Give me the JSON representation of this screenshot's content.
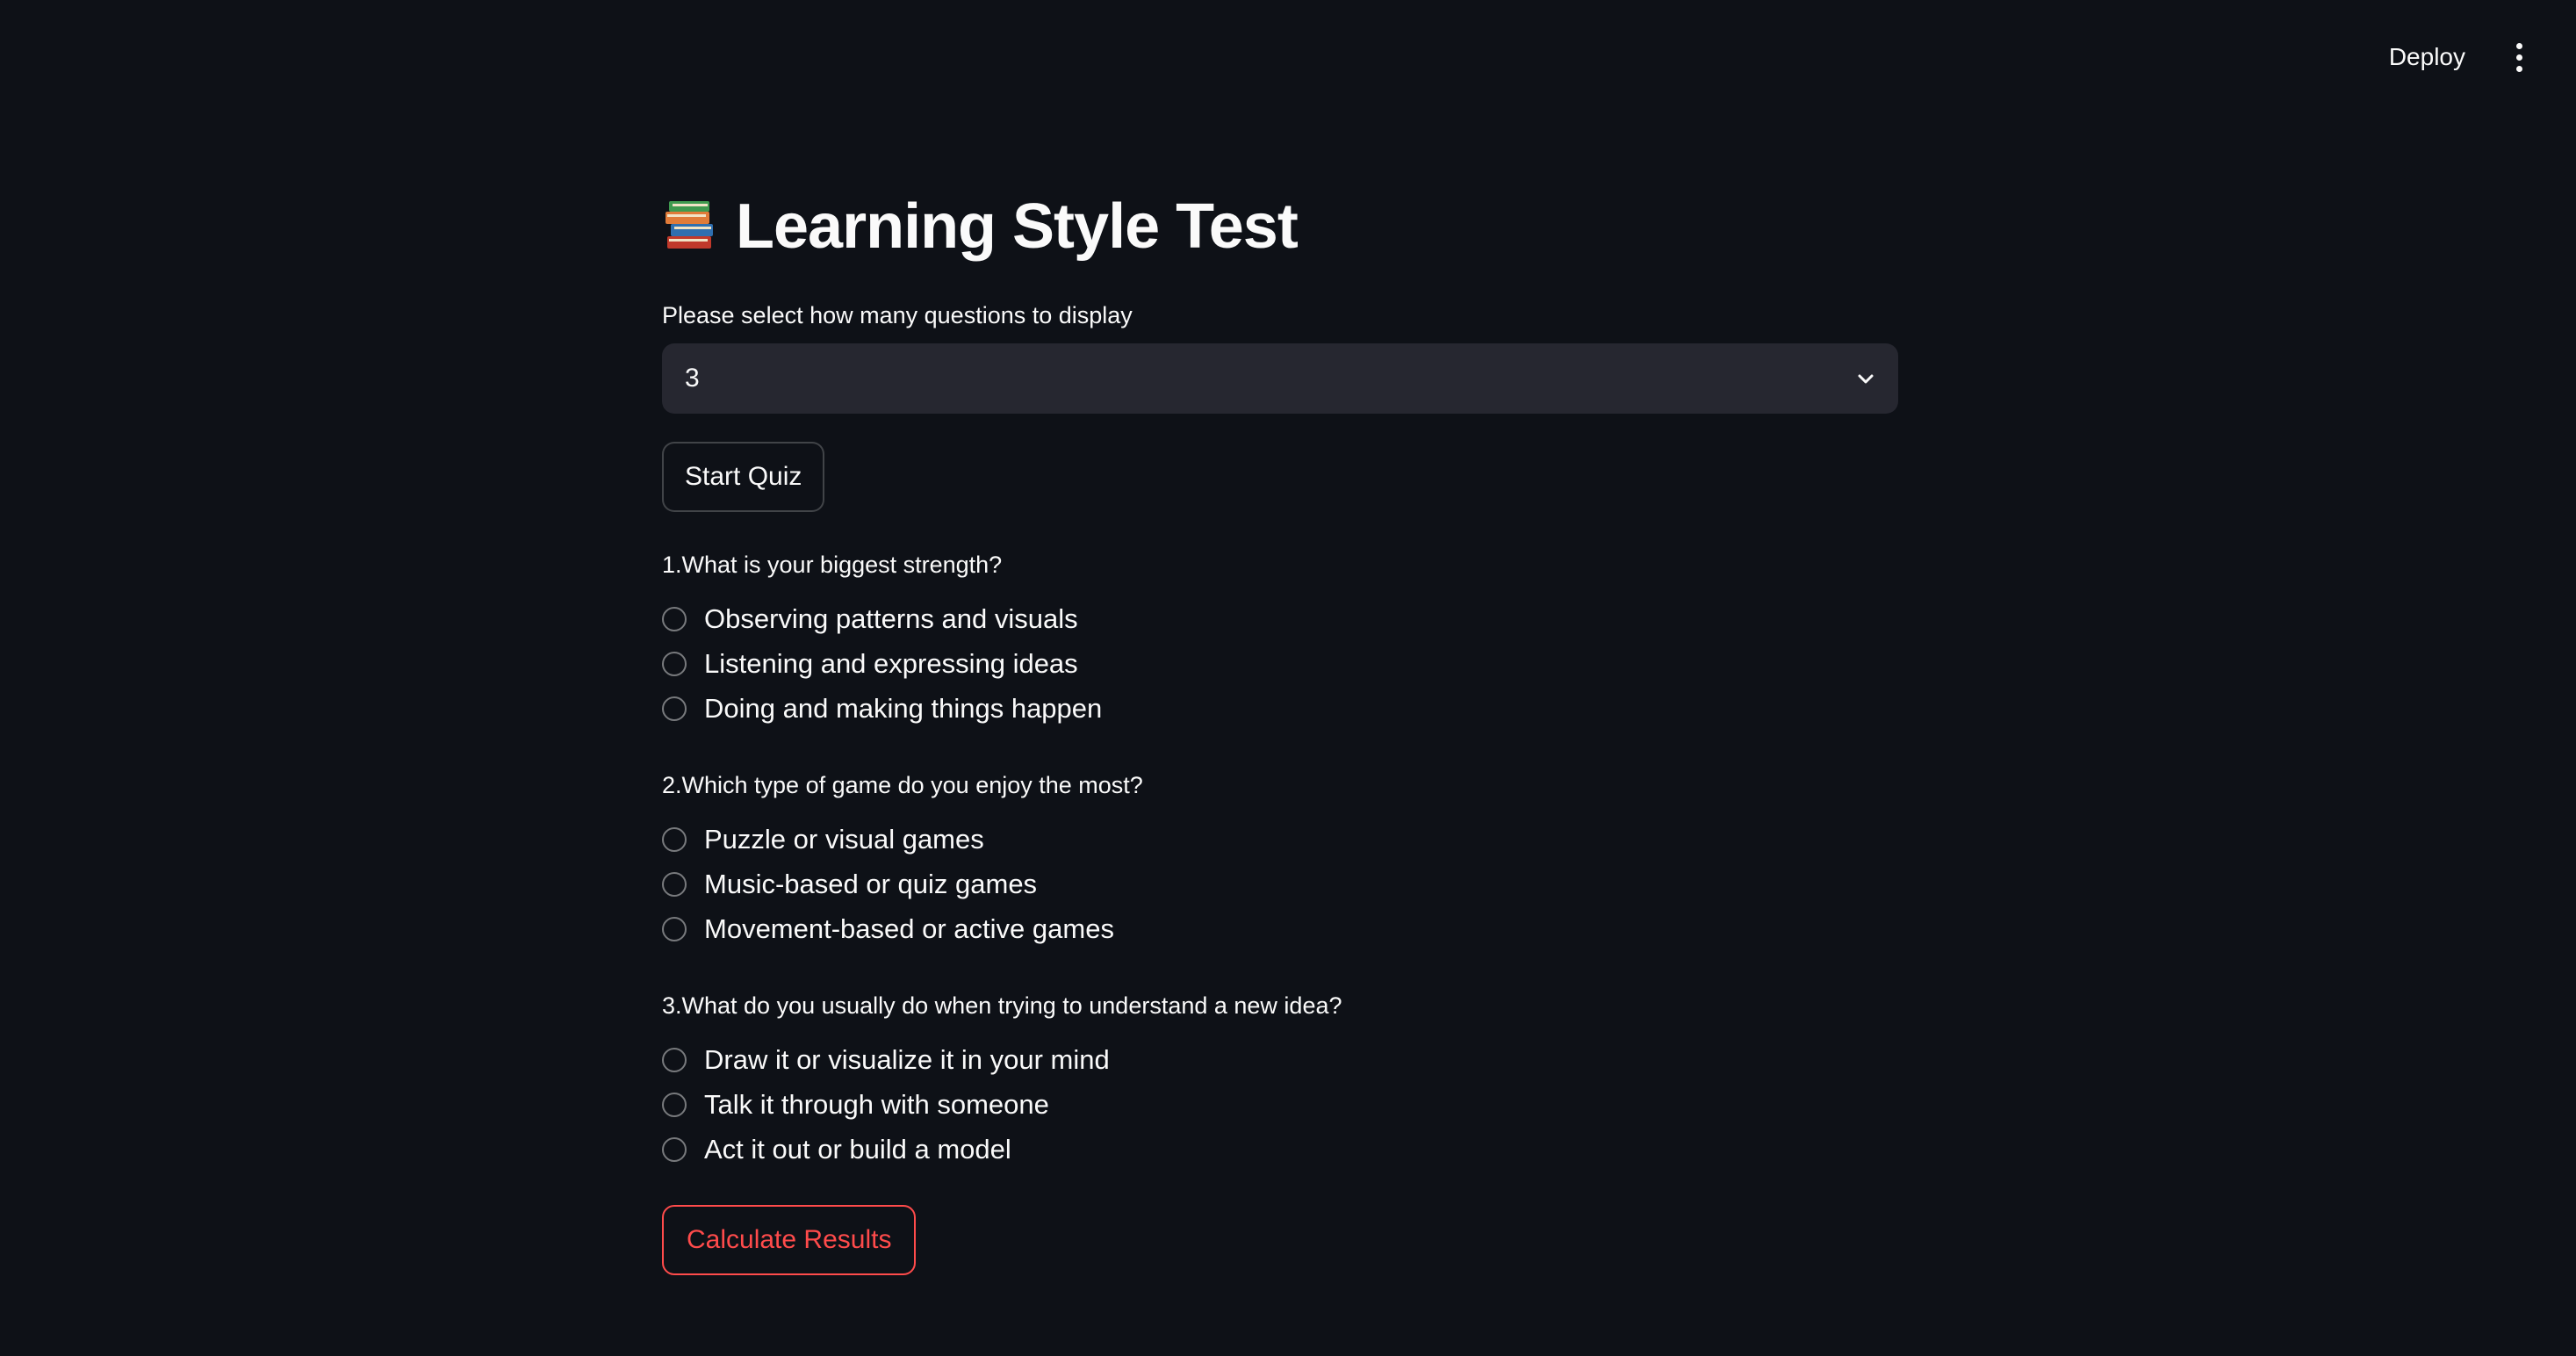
{
  "header": {
    "deploy_label": "Deploy",
    "menu_icon": "kebab-menu-icon"
  },
  "main": {
    "title_icon": "books-emoji-icon",
    "title": "Learning Style Test",
    "select_label": "Please select how many questions to display",
    "select_value": "3",
    "start_button": "Start Quiz",
    "questions": [
      {
        "label": "1.What is your biggest strength?",
        "options": [
          "Observing patterns and visuals",
          "Listening and expressing ideas",
          "Doing and making things happen"
        ]
      },
      {
        "label": "2.Which type of game do you enjoy the most?",
        "options": [
          "Puzzle or visual games",
          "Music-based or quiz games",
          "Movement-based or active games"
        ]
      },
      {
        "label": "3.What do you usually do when trying to understand a new idea?",
        "options": [
          "Draw it or visualize it in your mind",
          "Talk it through with someone",
          "Act it out or build a model"
        ]
      }
    ],
    "calculate_button": "Calculate Results"
  },
  "colors": {
    "background": "#0e1117",
    "select_bg": "#262730",
    "text": "#fafafa",
    "accent": "#ff4b4b"
  }
}
